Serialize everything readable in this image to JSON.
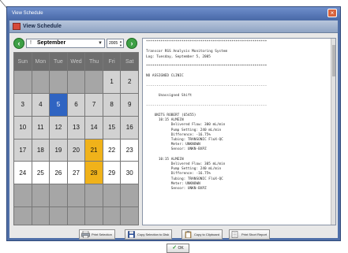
{
  "window": {
    "title": "View Schedule",
    "close_symbol": "×"
  },
  "header": {
    "title": "View Schedule",
    "icon": "calendar-icon"
  },
  "calendar": {
    "month": "September",
    "year": "2005",
    "info_symbol": "!",
    "prev_symbol": "‹",
    "next_symbol": "›",
    "weekdays": [
      "Sun",
      "Mon",
      "Tue",
      "Wed",
      "Thu",
      "Fri",
      "Sat"
    ],
    "days": [
      {
        "label": "",
        "style": "empty"
      },
      {
        "label": "",
        "style": "empty"
      },
      {
        "label": "",
        "style": "empty"
      },
      {
        "label": "",
        "style": "empty"
      },
      {
        "label": "",
        "style": "empty"
      },
      {
        "label": "1",
        "style": "normal"
      },
      {
        "label": "2",
        "style": "normal"
      },
      {
        "label": "3",
        "style": "normal"
      },
      {
        "label": "4",
        "style": "normal"
      },
      {
        "label": "5",
        "style": "selected"
      },
      {
        "label": "6",
        "style": "normal"
      },
      {
        "label": "7",
        "style": "normal"
      },
      {
        "label": "8",
        "style": "normal"
      },
      {
        "label": "9",
        "style": "normal"
      },
      {
        "label": "10",
        "style": "normal"
      },
      {
        "label": "11",
        "style": "normal"
      },
      {
        "label": "12",
        "style": "normal"
      },
      {
        "label": "13",
        "style": "normal"
      },
      {
        "label": "14",
        "style": "normal"
      },
      {
        "label": "15",
        "style": "normal"
      },
      {
        "label": "16",
        "style": "normal"
      },
      {
        "label": "17",
        "style": "normal"
      },
      {
        "label": "18",
        "style": "normal"
      },
      {
        "label": "19",
        "style": "normal"
      },
      {
        "label": "20",
        "style": "normal"
      },
      {
        "label": "21",
        "style": "highlight"
      },
      {
        "label": "22",
        "style": "white"
      },
      {
        "label": "23",
        "style": "white"
      },
      {
        "label": "24",
        "style": "white"
      },
      {
        "label": "25",
        "style": "white"
      },
      {
        "label": "26",
        "style": "white"
      },
      {
        "label": "27",
        "style": "white"
      },
      {
        "label": "28",
        "style": "highlight"
      },
      {
        "label": "29",
        "style": "white"
      },
      {
        "label": "30",
        "style": "white"
      },
      {
        "label": "",
        "style": "empty"
      },
      {
        "label": "",
        "style": "empty"
      },
      {
        "label": "",
        "style": "empty"
      },
      {
        "label": "",
        "style": "empty"
      },
      {
        "label": "",
        "style": "empty"
      },
      {
        "label": "",
        "style": "empty"
      },
      {
        "label": "",
        "style": "empty"
      },
      {
        "label": "",
        "style": "empty"
      },
      {
        "label": "",
        "style": "empty"
      },
      {
        "label": "",
        "style": "empty"
      },
      {
        "label": "",
        "style": "empty"
      },
      {
        "label": "",
        "style": "empty"
      },
      {
        "label": "",
        "style": "empty"
      },
      {
        "label": "",
        "style": "empty"
      }
    ],
    "colors": {
      "selected": "#2f64c2",
      "highlight": "#f0b21a",
      "header": "#6e6e6e"
    }
  },
  "report": {
    "text": "**********************************************************\n\nTranscor RSS Analysis Monitoring System\nLog: Tuesday, September 5, 2005\n\n**********************************************************\n\nNO ASSIGNED CLINIC\n\n----------------------------------------------------------\n\n      Unassigned Shift\n\n----------------------------------------------------------\n\n    UNITS ROBERT (65455)\n      10:15 ALMEIN\n            Delivered Flow: 300 mL/min\n            Pump Setting: 240 mL/min\n            Difference: -16.75%\n            Tubing: TRANSONIC FloX-QC\n            Meter: UNKNOWN\n            Sensor: UNKN-BXPZ\n\n      10:15 ALMEIN\n            Delivered Flow: 305 mL/min\n            Pump Setting: 240 mL/min\n            Difference: -16.75%\n            Tubing: TRANSONIC FloX-QC\n            Meter: UNKNOWN\n            Sensor: UNKN-BXPZ"
  },
  "buttons": [
    {
      "label": "Print Selection",
      "icon": "printer-icon"
    },
    {
      "label": "Copy Selection to Disk",
      "icon": "disk-icon"
    },
    {
      "label": "Copy to Clipboard",
      "icon": "clipboard-icon"
    },
    {
      "label": "Print Short Report",
      "icon": "print-report-icon"
    }
  ],
  "ok_button": {
    "label": "OK",
    "check": "✓"
  }
}
